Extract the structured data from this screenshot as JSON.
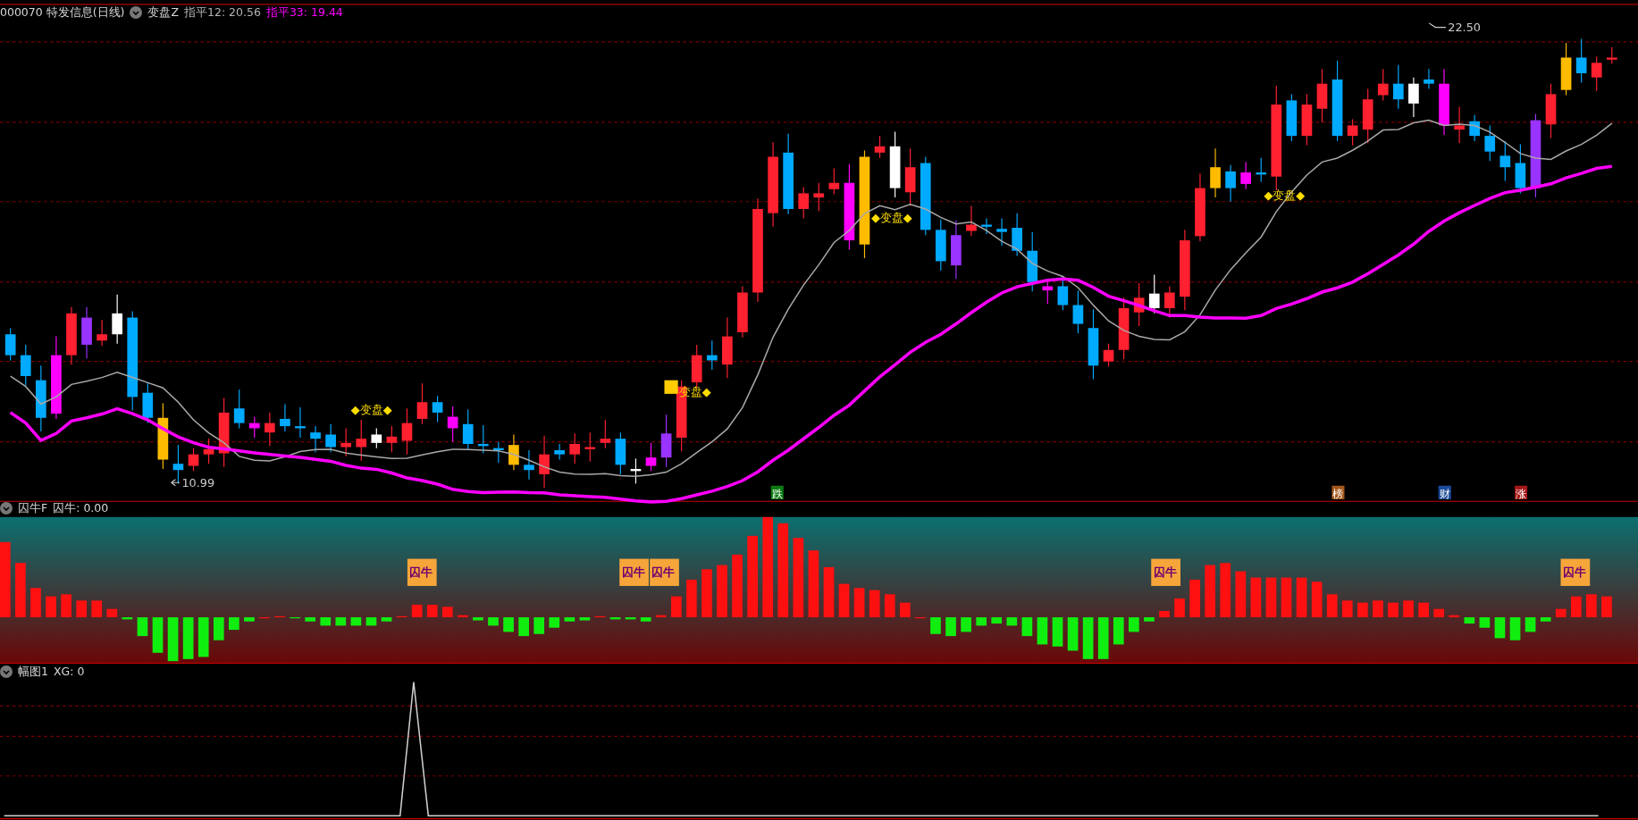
{
  "main_chart": {
    "symbol": "000070 特发信息(日线)",
    "indicator": "变盘Z",
    "readings": [
      {
        "text": "指平12: 20.56",
        "color": "#b4b4b4"
      },
      {
        "text": "指平33: 19.44",
        "color": "#ff00ff"
      }
    ],
    "high_label": "22.50",
    "low_label": "10.99",
    "markers": [
      {
        "text": "◆变盘◆",
        "kind": "plain"
      },
      {
        "text": "变盘◆",
        "kind": "boxed"
      },
      {
        "text": "◆变盘◆",
        "kind": "plain"
      },
      {
        "text": "◆变盘◆",
        "kind": "plain"
      }
    ],
    "signals": [
      {
        "text": "跌",
        "color": "#0b7a12"
      },
      {
        "text": "榜",
        "color": "#a4571c"
      },
      {
        "text": "财",
        "color": "#1d4b9a"
      },
      {
        "text": "涨",
        "color": "#a51818"
      }
    ]
  },
  "sub_chart": {
    "name": "囚牛F",
    "reading": "囚牛: 0.00",
    "tags": [
      "囚牛",
      "囚牛",
      "囚牛",
      "囚牛",
      "囚牛"
    ]
  },
  "signal_chart": {
    "name": "幅图1",
    "reading": "XG: 0"
  }
}
